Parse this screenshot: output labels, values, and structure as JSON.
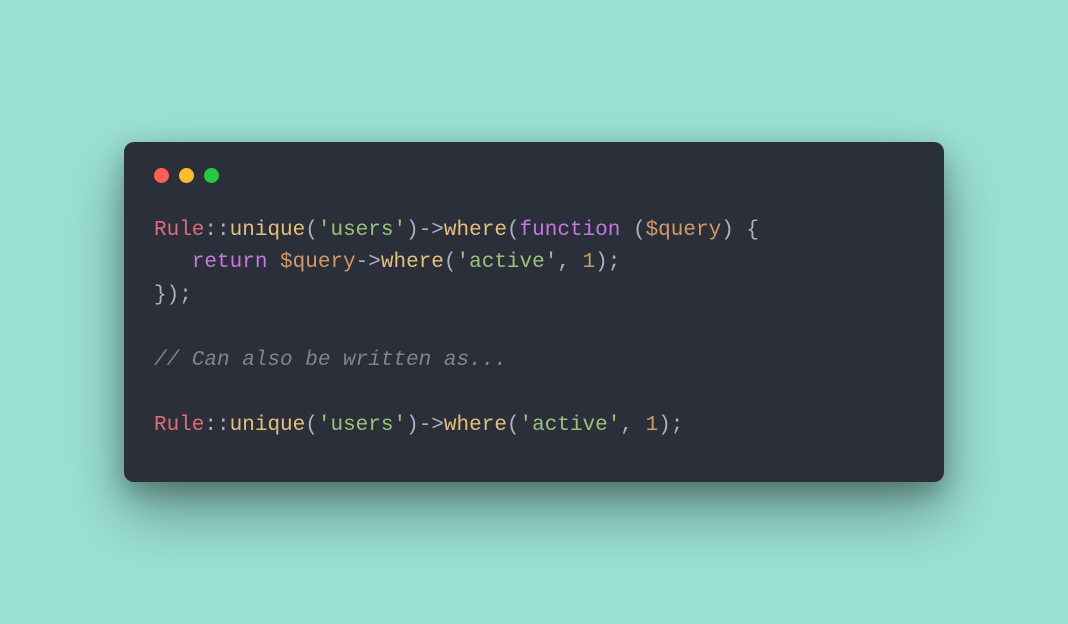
{
  "traffic_lights": [
    "red",
    "yellow",
    "green"
  ],
  "colors": {
    "class": "#e06c75",
    "op": "#abb2bf",
    "method": "#e5c07b",
    "string": "#98c379",
    "keyword": "#c678dd",
    "var": "#d19a66",
    "num": "#d19a66",
    "comment": "#7f848e",
    "bg_window": "#2a2f3a",
    "bg_page": "#9ae0d3"
  },
  "code_lines": [
    [
      {
        "t": "class",
        "v": "Rule"
      },
      {
        "t": "op",
        "v": "::"
      },
      {
        "t": "method",
        "v": "unique"
      },
      {
        "t": "op",
        "v": "("
      },
      {
        "t": "string",
        "v": "'users'"
      },
      {
        "t": "op",
        "v": ")->"
      },
      {
        "t": "method",
        "v": "where"
      },
      {
        "t": "op",
        "v": "("
      },
      {
        "t": "keyword",
        "v": "function"
      },
      {
        "t": "op",
        "v": " ("
      },
      {
        "t": "var",
        "v": "$query"
      },
      {
        "t": "op",
        "v": ") {"
      }
    ],
    [
      {
        "t": "op",
        "v": "   "
      },
      {
        "t": "keyword",
        "v": "return"
      },
      {
        "t": "op",
        "v": " "
      },
      {
        "t": "var",
        "v": "$query"
      },
      {
        "t": "op",
        "v": "->"
      },
      {
        "t": "method",
        "v": "where"
      },
      {
        "t": "op",
        "v": "("
      },
      {
        "t": "string",
        "v": "'active'"
      },
      {
        "t": "op",
        "v": ", "
      },
      {
        "t": "num",
        "v": "1"
      },
      {
        "t": "op",
        "v": ");"
      }
    ],
    [
      {
        "t": "op",
        "v": "});"
      }
    ],
    [],
    [
      {
        "t": "comment",
        "v": "// Can also be written as..."
      }
    ],
    [],
    [
      {
        "t": "class",
        "v": "Rule"
      },
      {
        "t": "op",
        "v": "::"
      },
      {
        "t": "method",
        "v": "unique"
      },
      {
        "t": "op",
        "v": "("
      },
      {
        "t": "string",
        "v": "'users'"
      },
      {
        "t": "op",
        "v": ")->"
      },
      {
        "t": "method",
        "v": "where"
      },
      {
        "t": "op",
        "v": "("
      },
      {
        "t": "string",
        "v": "'active'"
      },
      {
        "t": "op",
        "v": ", "
      },
      {
        "t": "num",
        "v": "1"
      },
      {
        "t": "op",
        "v": ");"
      }
    ]
  ],
  "code_plain": "Rule::unique('users')->where(function ($query) {\n   return $query->where('active', 1);\n});\n\n// Can also be written as...\n\nRule::unique('users')->where('active', 1);"
}
